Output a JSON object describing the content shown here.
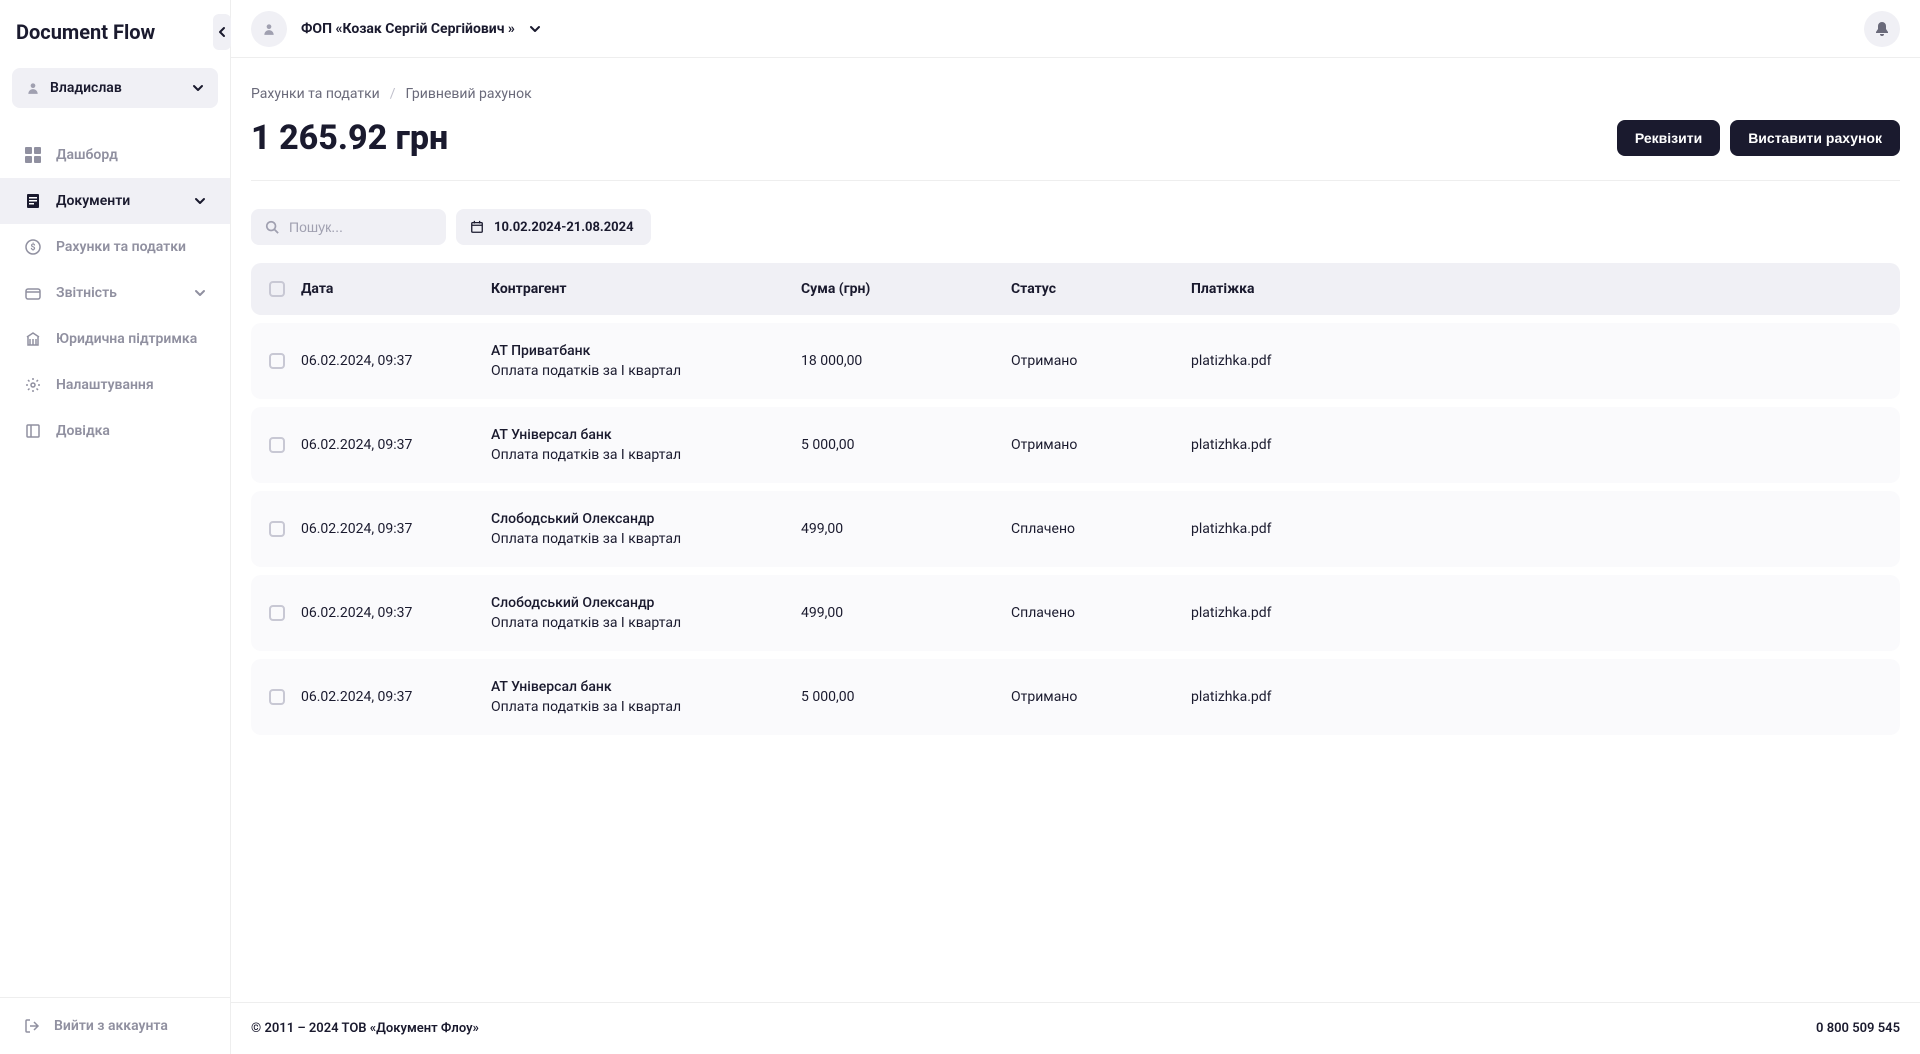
{
  "app": {
    "logo": "Document Flow"
  },
  "sidebar": {
    "user_name": "Владислав",
    "nav": [
      {
        "label": "Дашборд",
        "icon": "dashboard"
      },
      {
        "label": "Документи",
        "icon": "document",
        "active": true,
        "chevron": true
      },
      {
        "label": "Рахунки та податки",
        "icon": "money"
      },
      {
        "label": "Звітність",
        "icon": "wallet",
        "chevron": true
      },
      {
        "label": "Юридична підтримка",
        "icon": "building"
      },
      {
        "label": "Налаштування",
        "icon": "gear"
      },
      {
        "label": "Довідка",
        "icon": "book"
      }
    ],
    "logout": "Вийти з аккаунта"
  },
  "topbar": {
    "org_name": "ФОП «Козак Сергій Сергійович »"
  },
  "breadcrumb": {
    "a": "Рахунки та податки",
    "b": "Гривневий рахунок"
  },
  "balance": "1 265.92 грн",
  "buttons": {
    "requisites": "Реквізити",
    "invoice": "Виставити рахунок"
  },
  "filters": {
    "search_placeholder": "Пошук...",
    "date_range": "10.02.2024-21.08.2024"
  },
  "table": {
    "headers": {
      "date": "Дата",
      "kontr": "Контрагент",
      "sum": "Сума (грн)",
      "status": "Статус",
      "file": "Платіжка"
    },
    "rows": [
      {
        "date": "06.02.2024, 09:37",
        "kontr_name": "АТ Приватбанк",
        "kontr_desc": "Оплата податків за І квартал",
        "sum": "18 000,00",
        "status": "Отримано",
        "file": "platizhka.pdf"
      },
      {
        "date": "06.02.2024, 09:37",
        "kontr_name": "АТ Універсал банк",
        "kontr_desc": "Оплата податків за І квартал",
        "sum": "5 000,00",
        "status": "Отримано",
        "file": "platizhka.pdf"
      },
      {
        "date": "06.02.2024, 09:37",
        "kontr_name": "Слободський Олександр",
        "kontr_desc": "Оплата податків за І квартал",
        "sum": "499,00",
        "status": "Сплачено",
        "file": "platizhka.pdf"
      },
      {
        "date": "06.02.2024, 09:37",
        "kontr_name": "Слободський Олександр",
        "kontr_desc": "Оплата податків за І квартал",
        "sum": "499,00",
        "status": "Сплачено",
        "file": "platizhka.pdf"
      },
      {
        "date": "06.02.2024, 09:37",
        "kontr_name": "АТ Універсал банк",
        "kontr_desc": "Оплата податків за І квартал",
        "sum": "5 000,00",
        "status": "Отримано",
        "file": "platizhka.pdf"
      }
    ]
  },
  "footer": {
    "copyright": "© 2011 – 2024 ТОВ «Документ Флоу»",
    "phone": "0 800 509 545"
  }
}
